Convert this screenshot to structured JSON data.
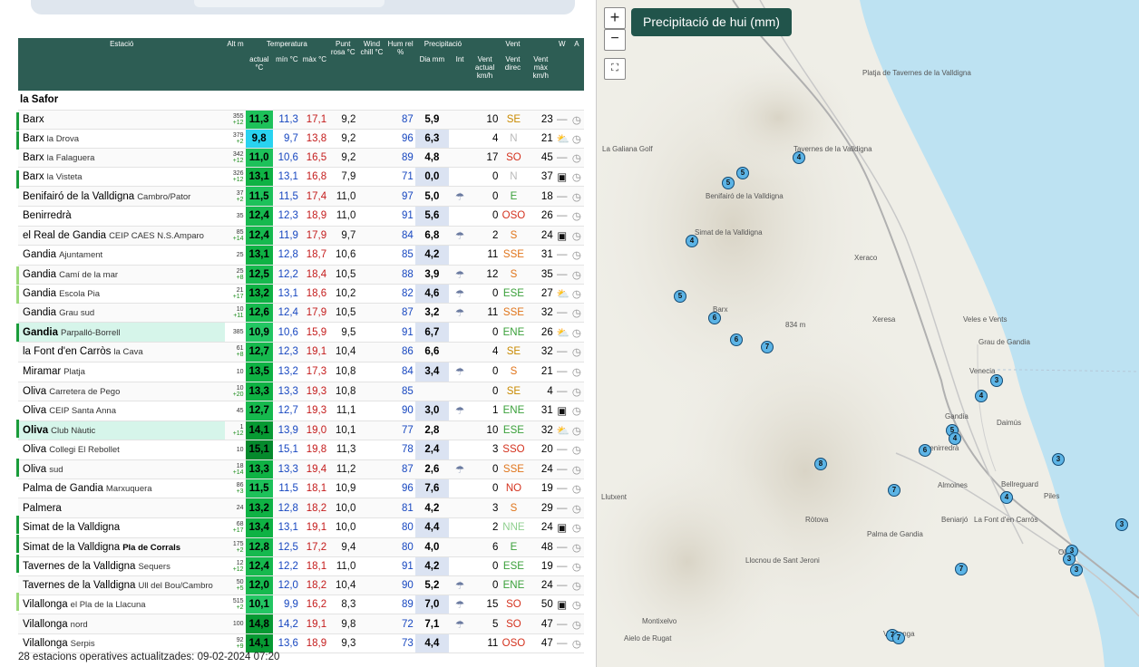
{
  "table": {
    "headers": {
      "station": "Estació",
      "alt": "Alt m",
      "temperature": "Temperatura",
      "temp_actual": "actual °C",
      "temp_min": "mín °C",
      "temp_max": "màx °C",
      "dew": "Punt rosa °C",
      "wind_chill": "Wind chill °C",
      "hum": "Hum rel %",
      "precip": "Precipitació",
      "precip_day": "Dia mm",
      "precip_int": "Int",
      "wind": "Vent",
      "wind_actual": "Vent actual km/h",
      "wind_dir": "Vent direc",
      "wind_max": "Vent màx km/h",
      "w": "W",
      "a": "A"
    },
    "region": "la Safor",
    "rows": [
      {
        "name": "Barx",
        "sub": "",
        "alt": "355",
        "diff": "+12",
        "act": "11,3",
        "min": "11,3",
        "max": "17,1",
        "dew": "9,2",
        "hum": "87",
        "day": "5,9",
        "int": "",
        "wact": "10",
        "wdir": "SE",
        "wmax": "23",
        "w": "—",
        "a": "◷",
        "mark": "#1a9c3a",
        "actbg": "#1dc15a",
        "wdircol": "#c98a00",
        "hl": ""
      },
      {
        "name": "Barx",
        "sub": "la Drova",
        "alt": "379",
        "diff": "+2",
        "act": "9,8",
        "min": "9,7",
        "max": "13,8",
        "dew": "9,2",
        "hum": "96",
        "day": "6,3",
        "int": "",
        "wact": "4",
        "wdir": "N",
        "wmax": "21",
        "w": "⛅",
        "a": "◷",
        "mark": "#1a9c3a",
        "actbg": "#29d3f0",
        "wdircol": "#b9b9b9",
        "hl": ""
      },
      {
        "name": "Barx",
        "sub": "la Falaguera",
        "alt": "342",
        "diff": "+12",
        "act": "11,0",
        "min": "10,6",
        "max": "16,5",
        "dew": "9,2",
        "hum": "89",
        "day": "4,8",
        "int": "",
        "wact": "17",
        "wdir": "SO",
        "wmax": "45",
        "w": "—",
        "a": "◷",
        "mark": "",
        "actbg": "#1dc15a",
        "wdircol": "#d4321e",
        "hl": ""
      },
      {
        "name": "Barx",
        "sub": "la Visteta",
        "alt": "326",
        "diff": "+12",
        "act": "13,1",
        "min": "13,1",
        "max": "16,8",
        "dew": "7,9",
        "hum": "71",
        "day": "0,0",
        "int": "",
        "wact": "0",
        "wdir": "N",
        "wmax": "37",
        "w": "▣",
        "a": "◷",
        "mark": "#1a9c3a",
        "actbg": "#0fb244",
        "wdircol": "#b9b9b9",
        "hl": ""
      },
      {
        "name": "Benifairó de la Valldigna",
        "sub": "Cambro/Pator",
        "alt": "37",
        "diff": "+2",
        "act": "11,5",
        "min": "11,5",
        "max": "17,4",
        "dew": "11,0",
        "hum": "97",
        "day": "5,0",
        "int": "☂",
        "wact": "0",
        "wdir": "E",
        "wmax": "18",
        "w": "—",
        "a": "◷",
        "mark": "",
        "actbg": "#1dc15a",
        "wdircol": "#3aa03a",
        "hl": ""
      },
      {
        "name": "Benirredrà",
        "sub": "",
        "alt": "35",
        "diff": "",
        "act": "12,4",
        "min": "12,3",
        "max": "18,9",
        "dew": "11,0",
        "hum": "91",
        "day": "5,6",
        "int": "",
        "wact": "0",
        "wdir": "OSO",
        "wmax": "26",
        "w": "—",
        "a": "◷",
        "mark": "",
        "actbg": "#16b94e",
        "wdircol": "#d4321e",
        "hl": ""
      },
      {
        "name": "el Real de Gandia",
        "sub": "CEIP CAES N.S.Amparo",
        "alt": "85",
        "diff": "+14",
        "act": "12,4",
        "min": "11,9",
        "max": "17,9",
        "dew": "9,7",
        "hum": "84",
        "day": "6,8",
        "int": "☂",
        "wact": "2",
        "wdir": "S",
        "wmax": "24",
        "w": "▣",
        "a": "◷",
        "mark": "",
        "actbg": "#16b94e",
        "wdircol": "#e0741a",
        "hl": ""
      },
      {
        "name": "Gandia",
        "sub": "Ajuntament",
        "alt": "25",
        "diff": "",
        "act": "13,1",
        "min": "12,8",
        "max": "18,7",
        "dew": "10,6",
        "hum": "85",
        "day": "4,2",
        "int": "",
        "wact": "11",
        "wdir": "SSE",
        "wmax": "31",
        "w": "—",
        "a": "◷",
        "mark": "",
        "actbg": "#0fb244",
        "wdircol": "#e0741a",
        "hl": ""
      },
      {
        "name": "Gandia",
        "sub": "Camí de la mar",
        "alt": "25",
        "diff": "+8",
        "act": "12,5",
        "min": "12,2",
        "max": "18,4",
        "dew": "10,5",
        "hum": "88",
        "day": "3,9",
        "int": "☂",
        "wact": "12",
        "wdir": "S",
        "wmax": "35",
        "w": "—",
        "a": "◷",
        "mark": "#9bd97a",
        "actbg": "#16b94e",
        "wdircol": "#e0741a",
        "hl": ""
      },
      {
        "name": "Gandia",
        "sub": "Escola Pia",
        "alt": "21",
        "diff": "+17",
        "act": "13,2",
        "min": "13,1",
        "max": "18,6",
        "dew": "10,2",
        "hum": "82",
        "day": "4,6",
        "int": "☂",
        "wact": "0",
        "wdir": "ESE",
        "wmax": "27",
        "w": "⛅",
        "a": "◷",
        "mark": "#9bd97a",
        "actbg": "#0fb244",
        "wdircol": "#3aa03a",
        "hl": ""
      },
      {
        "name": "Gandia",
        "sub": "Grau sud",
        "alt": "10",
        "diff": "+11",
        "act": "12,6",
        "min": "12,4",
        "max": "17,9",
        "dew": "10,5",
        "hum": "87",
        "day": "3,2",
        "int": "☂",
        "wact": "11",
        "wdir": "SSE",
        "wmax": "32",
        "w": "—",
        "a": "◷",
        "mark": "",
        "actbg": "#16b94e",
        "wdircol": "#e0741a",
        "hl": ""
      },
      {
        "name": "Gandia",
        "sub": "Parpalló-Borrell",
        "alt": "385",
        "diff": "",
        "act": "10,9",
        "min": "10,6",
        "max": "15,9",
        "dew": "9,5",
        "hum": "91",
        "day": "6,7",
        "int": "",
        "wact": "0",
        "wdir": "ENE",
        "wmax": "26",
        "w": "⛅",
        "a": "◷",
        "mark": "#1a9c3a",
        "actbg": "#23c663",
        "wdircol": "#3aa03a",
        "hl": "#d6f5ea",
        "bold": true
      },
      {
        "name": "la Font d'en Carròs",
        "sub": "la Cava",
        "alt": "61",
        "diff": "+8",
        "act": "12,7",
        "min": "12,3",
        "max": "19,1",
        "dew": "10,4",
        "hum": "86",
        "day": "6,6",
        "int": "",
        "wact": "4",
        "wdir": "SE",
        "wmax": "32",
        "w": "—",
        "a": "◷",
        "mark": "",
        "actbg": "#16b94e",
        "wdircol": "#c98a00",
        "hl": ""
      },
      {
        "name": "Miramar",
        "sub": "Platja",
        "alt": "10",
        "diff": "",
        "act": "13,5",
        "min": "13,2",
        "max": "17,3",
        "dew": "10,8",
        "hum": "84",
        "day": "3,4",
        "int": "☂",
        "wact": "0",
        "wdir": "S",
        "wmax": "21",
        "w": "—",
        "a": "◷",
        "mark": "",
        "actbg": "#0fb244",
        "wdircol": "#e0741a",
        "hl": ""
      },
      {
        "name": "Oliva",
        "sub": "Carretera de Pego",
        "alt": "10",
        "diff": "+20",
        "act": "13,3",
        "min": "13,3",
        "max": "19,3",
        "dew": "10,8",
        "hum": "85",
        "day": "",
        "int": "",
        "wact": "0",
        "wdir": "SE",
        "wmax": "4",
        "w": "—",
        "a": "◷",
        "mark": "",
        "actbg": "#0fb244",
        "wdircol": "#c98a00",
        "hl": ""
      },
      {
        "name": "Oliva",
        "sub": "CEIP Santa Anna",
        "alt": "45",
        "diff": "",
        "act": "12,7",
        "min": "12,7",
        "max": "19,3",
        "dew": "11,1",
        "hum": "90",
        "day": "3,0",
        "int": "☂",
        "wact": "1",
        "wdir": "ENE",
        "wmax": "31",
        "w": "▣",
        "a": "◷",
        "mark": "",
        "actbg": "#16b94e",
        "wdircol": "#3aa03a",
        "hl": ""
      },
      {
        "name": "Oliva",
        "sub": "Club Nàutic",
        "alt": "1",
        "diff": "+12",
        "act": "14,1",
        "min": "13,9",
        "max": "19,0",
        "dew": "10,1",
        "hum": "77",
        "day": "2,8",
        "int": "",
        "wact": "10",
        "wdir": "ESE",
        "wmax": "32",
        "w": "⛅",
        "a": "◷",
        "mark": "#1a9c3a",
        "actbg": "#079a33",
        "wdircol": "#3aa03a",
        "hl": "#d6f5ea",
        "bold": true
      },
      {
        "name": "Oliva",
        "sub": "Collegi El Rebollet",
        "alt": "10",
        "diff": "",
        "act": "15,1",
        "min": "15,1",
        "max": "19,8",
        "dew": "11,3",
        "hum": "78",
        "day": "2,4",
        "int": "",
        "wact": "3",
        "wdir": "SSO",
        "wmax": "20",
        "w": "—",
        "a": "◷",
        "mark": "",
        "actbg": "#058a2d",
        "wdircol": "#d4321e",
        "hl": ""
      },
      {
        "name": "Oliva",
        "sub": "sud",
        "alt": "18",
        "diff": "+14",
        "act": "13,3",
        "min": "13,3",
        "max": "19,4",
        "dew": "11,2",
        "hum": "87",
        "day": "2,6",
        "int": "☂",
        "wact": "0",
        "wdir": "SSE",
        "wmax": "24",
        "w": "—",
        "a": "◷",
        "mark": "#1a9c3a",
        "actbg": "#0fb244",
        "wdircol": "#e0741a",
        "hl": ""
      },
      {
        "name": "Palma de Gandia",
        "sub": "Marxuquera",
        "alt": "86",
        "diff": "+3",
        "act": "11,5",
        "min": "11,5",
        "max": "18,1",
        "dew": "10,9",
        "hum": "96",
        "day": "7,6",
        "int": "",
        "wact": "0",
        "wdir": "NO",
        "wmax": "19",
        "w": "—",
        "a": "◷",
        "mark": "",
        "actbg": "#1dc15a",
        "wdircol": "#d4321e",
        "hl": ""
      },
      {
        "name": "Palmera",
        "sub": "",
        "alt": "24",
        "diff": "",
        "act": "13,2",
        "min": "12,8",
        "max": "18,2",
        "dew": "10,0",
        "hum": "81",
        "day": "4,2",
        "int": "",
        "wact": "3",
        "wdir": "S",
        "wmax": "29",
        "w": "—",
        "a": "◷",
        "mark": "",
        "actbg": "#0fb244",
        "wdircol": "#e0741a",
        "hl": ""
      },
      {
        "name": "Simat de la Valldigna",
        "sub": "",
        "alt": "68",
        "diff": "+17",
        "act": "13,4",
        "min": "13,1",
        "max": "19,1",
        "dew": "10,0",
        "hum": "80",
        "day": "4,4",
        "int": "",
        "wact": "2",
        "wdir": "NNE",
        "wmax": "24",
        "w": "▣",
        "a": "◷",
        "mark": "#1a9c3a",
        "actbg": "#0fb244",
        "wdircol": "#8fcf8f",
        "hl": ""
      },
      {
        "name": "Simat de la Valldigna",
        "sub": "Pla de Corrals",
        "subbold": true,
        "alt": "175",
        "diff": "+2",
        "act": "12,8",
        "min": "12,5",
        "max": "17,2",
        "dew": "9,4",
        "hum": "80",
        "day": "4,0",
        "int": "",
        "wact": "6",
        "wdir": "E",
        "wmax": "48",
        "w": "—",
        "a": "◷",
        "mark": "#1a9c3a",
        "actbg": "#16b94e",
        "wdircol": "#3aa03a",
        "hl": ""
      },
      {
        "name": "Tavernes de la Valldigna",
        "sub": "Sequers",
        "alt": "12",
        "diff": "+12",
        "act": "12,4",
        "min": "12,2",
        "max": "18,1",
        "dew": "11,0",
        "hum": "91",
        "day": "4,2",
        "int": "",
        "wact": "0",
        "wdir": "ESE",
        "wmax": "19",
        "w": "—",
        "a": "◷",
        "mark": "#1a9c3a",
        "actbg": "#16b94e",
        "wdircol": "#3aa03a",
        "hl": ""
      },
      {
        "name": "Tavernes de la Valldigna",
        "sub": "Ull del Bou/Cambro",
        "alt": "50",
        "diff": "+5",
        "act": "12,0",
        "min": "12,0",
        "max": "18,2",
        "dew": "10,4",
        "hum": "90",
        "day": "5,2",
        "int": "☂",
        "wact": "0",
        "wdir": "ENE",
        "wmax": "24",
        "w": "—",
        "a": "◷",
        "mark": "",
        "actbg": "#16b94e",
        "wdircol": "#3aa03a",
        "hl": ""
      },
      {
        "name": "Vilallonga",
        "sub": "el Pla de la Llacuna",
        "alt": "515",
        "diff": "+2",
        "act": "10,1",
        "min": "9,9",
        "max": "16,2",
        "dew": "8,3",
        "hum": "89",
        "day": "7,0",
        "int": "☂",
        "wact": "15",
        "wdir": "SO",
        "wmax": "50",
        "w": "▣",
        "a": "◷",
        "mark": "#9bd97a",
        "actbg": "#23c663",
        "wdircol": "#d4321e",
        "hl": ""
      },
      {
        "name": "Vilallonga",
        "sub": "nord",
        "alt": "100",
        "diff": "",
        "act": "14,8",
        "min": "14,2",
        "max": "19,1",
        "dew": "9,8",
        "hum": "72",
        "day": "7,1",
        "int": "☂",
        "wact": "5",
        "wdir": "SO",
        "wmax": "47",
        "w": "—",
        "a": "◷",
        "mark": "",
        "actbg": "#079a33",
        "wdircol": "#d4321e",
        "hl": ""
      },
      {
        "name": "Vilallonga",
        "sub": "Serpis",
        "alt": "92",
        "diff": "+9",
        "act": "14,1",
        "min": "13,6",
        "max": "18,9",
        "dew": "9,3",
        "hum": "73",
        "day": "4,4",
        "int": "",
        "wact": "11",
        "wdir": "OSO",
        "wmax": "47",
        "w": "—",
        "a": "◷",
        "mark": "",
        "actbg": "#079a33",
        "wdircol": "#d4321e",
        "hl": ""
      }
    ]
  },
  "footer": {
    "count": "28",
    "text_before": "estacions operatives actualitzades:",
    "datetime": "09-02-2024 07:20"
  },
  "map": {
    "title": "Precipitació de hui (mm)",
    "zoom_in": "+",
    "zoom_out": "−",
    "fullscreen": "⛶",
    "places": [
      {
        "t": "Platja de Tavernes de la Valldigna"
      },
      {
        "t": "La Galiana Golf"
      },
      {
        "t": "Tavernes de la Valldigna"
      },
      {
        "t": "Benifairó de la Valldigna"
      },
      {
        "t": "Simat de la Valldigna"
      },
      {
        "t": "Xeraco"
      },
      {
        "t": "Barx"
      },
      {
        "t": "834 m"
      },
      {
        "t": "Xeresa"
      },
      {
        "t": "Veles e Vents"
      },
      {
        "t": "Grau de Gandia"
      },
      {
        "t": "Venecia"
      },
      {
        "t": "Gandia"
      },
      {
        "t": "Daimús"
      },
      {
        "t": "Benirredrà"
      },
      {
        "t": "Almoines"
      },
      {
        "t": "Bellreguard"
      },
      {
        "t": "Piles"
      },
      {
        "t": "Llutxent"
      },
      {
        "t": "Ròtova"
      },
      {
        "t": "Palma de Gandia"
      },
      {
        "t": "Beniarjó"
      },
      {
        "t": "La Font d'en Carròs"
      },
      {
        "t": "Oliva"
      },
      {
        "t": "Llocnou de Sant Jeroni"
      },
      {
        "t": "Montixelvo"
      },
      {
        "t": "Vilallonga"
      },
      {
        "t": "Aielo de Rugat"
      }
    ],
    "markers": [
      "4",
      "5",
      "5",
      "4",
      "5",
      "6",
      "6",
      "7",
      "3",
      "4",
      "5",
      "4",
      "6",
      "8",
      "7",
      "3",
      "4",
      "3",
      "3",
      "3",
      "3",
      "7",
      "7",
      "7"
    ]
  },
  "colors": {
    "header": "#2d5d54",
    "accent": "#21544b",
    "water": "#bde2f2"
  }
}
